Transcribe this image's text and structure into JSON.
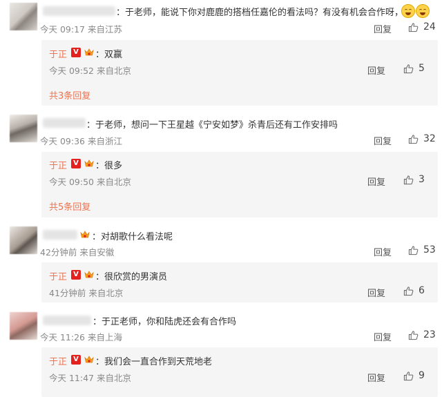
{
  "comments": [
    {
      "text": "：于老师，能说下你对鹿鹿的搭档任嘉伦的看法吗？有没有机会合作呀，",
      "time": "今天 09:17",
      "source": "来自江苏",
      "reply_label": "回复",
      "likes": "24",
      "reply": {
        "name": "于正",
        "text": "：双赢",
        "time": "今天 09:52",
        "source": "来自北京",
        "reply_label": "回复",
        "likes": "5"
      },
      "more": "共3条回复"
    },
    {
      "text": "：于老师，想问一下王星越《宁安如梦》杀青后还有工作安排吗",
      "time": "今天 09:36",
      "source": "来自浙江",
      "reply_label": "回复",
      "likes": "32",
      "reply": {
        "name": "于正",
        "text": "：很多",
        "time": "今天 09:50",
        "source": "来自北京",
        "reply_label": "回复",
        "likes": "3"
      },
      "more": "共5条回复"
    },
    {
      "text": "：对胡歌什么看法呢",
      "time": "42分钟前",
      "source": "来自安徽",
      "reply_label": "回复",
      "likes": "53",
      "reply": {
        "name": "于正",
        "text": "：很欣赏的男演员",
        "time": "41分钟前",
        "source": "来自北京",
        "reply_label": "回复",
        "likes": "6"
      }
    },
    {
      "text": "：于正老师，你和陆虎还会有合作吗",
      "time": "今天 11:26",
      "source": "来自上海",
      "reply_label": "回复",
      "likes": "23",
      "reply": {
        "name": "于正",
        "text": "：我们会一直合作到天荒地老",
        "time": "今天 11:47",
        "source": "来自北京",
        "reply_label": "回复",
        "likes": "9"
      }
    }
  ],
  "colors": {
    "name": "#eb7350",
    "badge": "#e3211e",
    "meta": "#888888",
    "subbox": "#f5f5f5"
  },
  "icons": {
    "like": "thumbs-up-icon",
    "verified": "v-badge-icon",
    "membership": "crown-icon",
    "emoji": "laughing-emoji-icon"
  }
}
